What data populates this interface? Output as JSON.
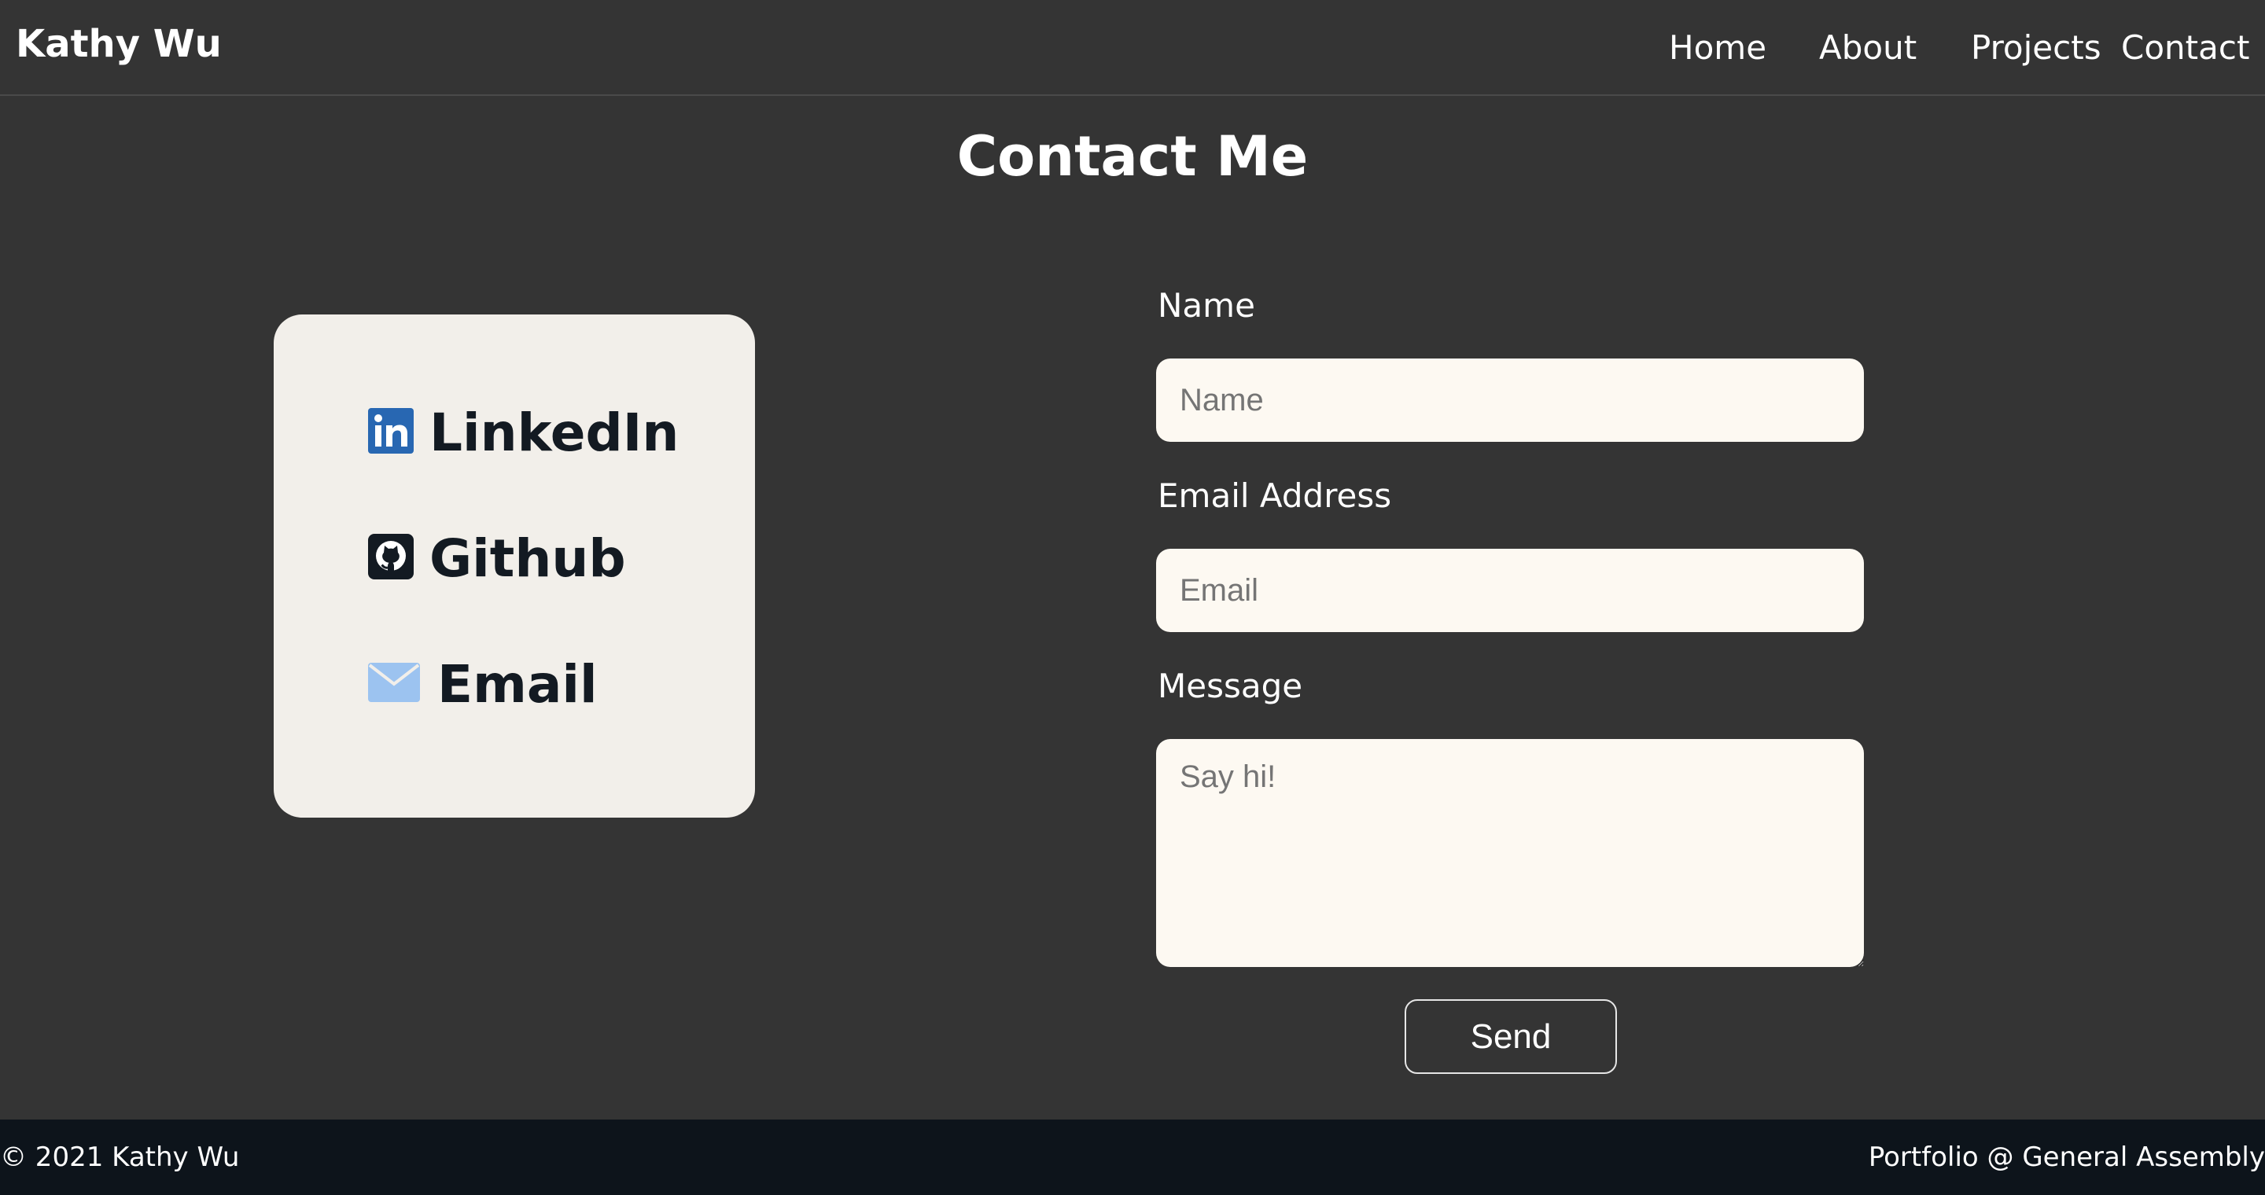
{
  "header": {
    "brand": "Kathy Wu",
    "nav": {
      "home": "Home",
      "about": "About",
      "projects": "Projects",
      "contact": "Contact"
    }
  },
  "page_title": "Contact Me",
  "links_card": {
    "items": [
      {
        "label": "LinkedIn",
        "icon": "linkedin-icon"
      },
      {
        "label": "Github",
        "icon": "github-icon"
      },
      {
        "label": "Email",
        "icon": "envelope-icon"
      }
    ]
  },
  "form": {
    "name_label": "Name",
    "name_placeholder": "Name",
    "email_label": "Email Address",
    "email_placeholder": "Email",
    "message_label": "Message",
    "message_placeholder": "Say hi!",
    "send_label": "Send"
  },
  "footer": {
    "left": "© 2021 Kathy Wu",
    "right": "Portfolio @ General Assembly"
  },
  "colors": {
    "background": "#343434",
    "card": "#f2efea",
    "input": "#fdf9f2",
    "footer": "#0d141b",
    "linkedin": "#2867b2",
    "github": "#131a22",
    "email": "#9cc3f0"
  }
}
